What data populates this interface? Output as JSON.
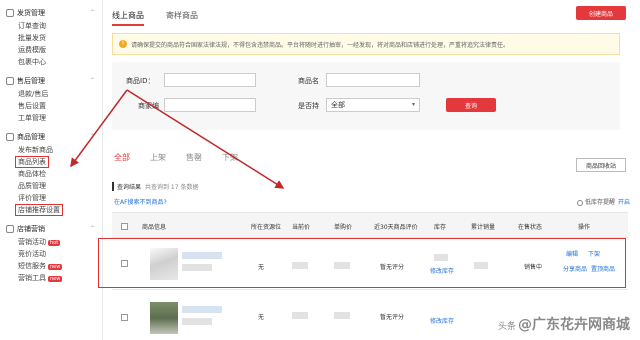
{
  "sidebar": {
    "groups": [
      {
        "title": "发货管理",
        "items": [
          "订单查询",
          "批量发货",
          "运费模版",
          "包裹中心"
        ]
      },
      {
        "title": "售后管理",
        "items": [
          "退款/售后",
          "售后设置",
          "工单管理"
        ]
      },
      {
        "title": "商品管理",
        "items": [
          "发布新商品",
          "商品列表",
          "商品体检",
          "品质管理",
          "评价管理",
          "店铺推荐设置"
        ]
      },
      {
        "title": "店铺营销",
        "items": [
          "营销活动",
          "竞价活动",
          "短信服务",
          "营销工具"
        ]
      }
    ],
    "badges": {
      "promo": "hot",
      "sms": "new",
      "tools": "new"
    }
  },
  "top_tabs": [
    "线上商品",
    "寄样商品"
  ],
  "create_button": "创建商品",
  "notice": "请确保提交的商品符合国家法律法规，不得包含违禁商品。平台将随时进行抽审，一经发现，将对商品和店铺进行处理，严重将追究法律责任。",
  "filter": {
    "id_label": "商品ID：",
    "name_label": "商品名",
    "code_label": "商家编",
    "status_label": "是否持",
    "status_value": "全部",
    "search_button": "查询"
  },
  "status_tabs": [
    "全部",
    "上架",
    "售罄",
    "下架"
  ],
  "recycle_button": "商品回收站",
  "result": {
    "label": "查询结果",
    "count_text": "共查询到 17 条数据"
  },
  "not_found_link": "在AF搜索不到商品?",
  "low_stock": {
    "label": "低库存提醒",
    "action": "开启"
  },
  "columns": [
    "商品信息",
    "所在资源位",
    "当前价",
    "单购价",
    "近30天商品评价",
    "库存",
    "累计销量",
    "在售状态",
    "操作"
  ],
  "rows": [
    {
      "resource": "无",
      "review": "暂无评分",
      "stock_action": "修改库存",
      "status": "销售中",
      "ops": [
        "编辑",
        "下架",
        "分享商品",
        "置顶商品"
      ]
    },
    {
      "resource": "无",
      "review": "暂无评分",
      "stock_action": "修改库存"
    }
  ],
  "watermark": {
    "prefix": "头条",
    "text": "@广东花卉网商城"
  },
  "colors": {
    "accent": "#e4393c",
    "link": "#1e6fd9",
    "annotation": "#d33333"
  }
}
